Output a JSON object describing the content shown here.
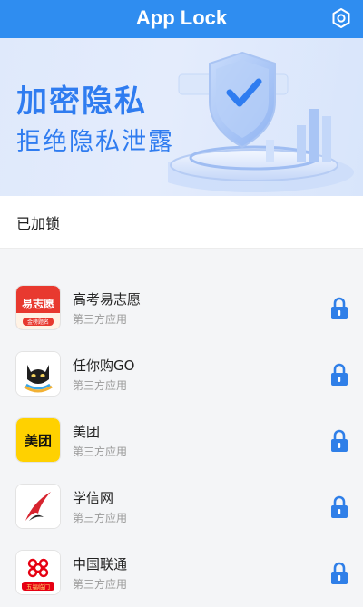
{
  "header": {
    "title": "App Lock",
    "settings_icon": "gear-icon"
  },
  "banner": {
    "line1": "加密隐私",
    "line2": "拒绝隐私泄露"
  },
  "section": {
    "title": "已加锁"
  },
  "apps": [
    {
      "name": "高考易志愿",
      "type": "第三方应用",
      "icon_text": "易志愿",
      "icon_badge": "金榜题名",
      "locked": true
    },
    {
      "name": "任你购GO",
      "type": "第三方应用",
      "locked": true
    },
    {
      "name": "美团",
      "type": "第三方应用",
      "icon_text": "美团",
      "locked": true
    },
    {
      "name": "学信网",
      "type": "第三方应用",
      "locked": true
    },
    {
      "name": "中国联通",
      "type": "第三方应用",
      "icon_badge": "五福临门",
      "locked": true
    }
  ],
  "colors": {
    "accent": "#2f8df0",
    "lock": "#2f7fe8"
  }
}
